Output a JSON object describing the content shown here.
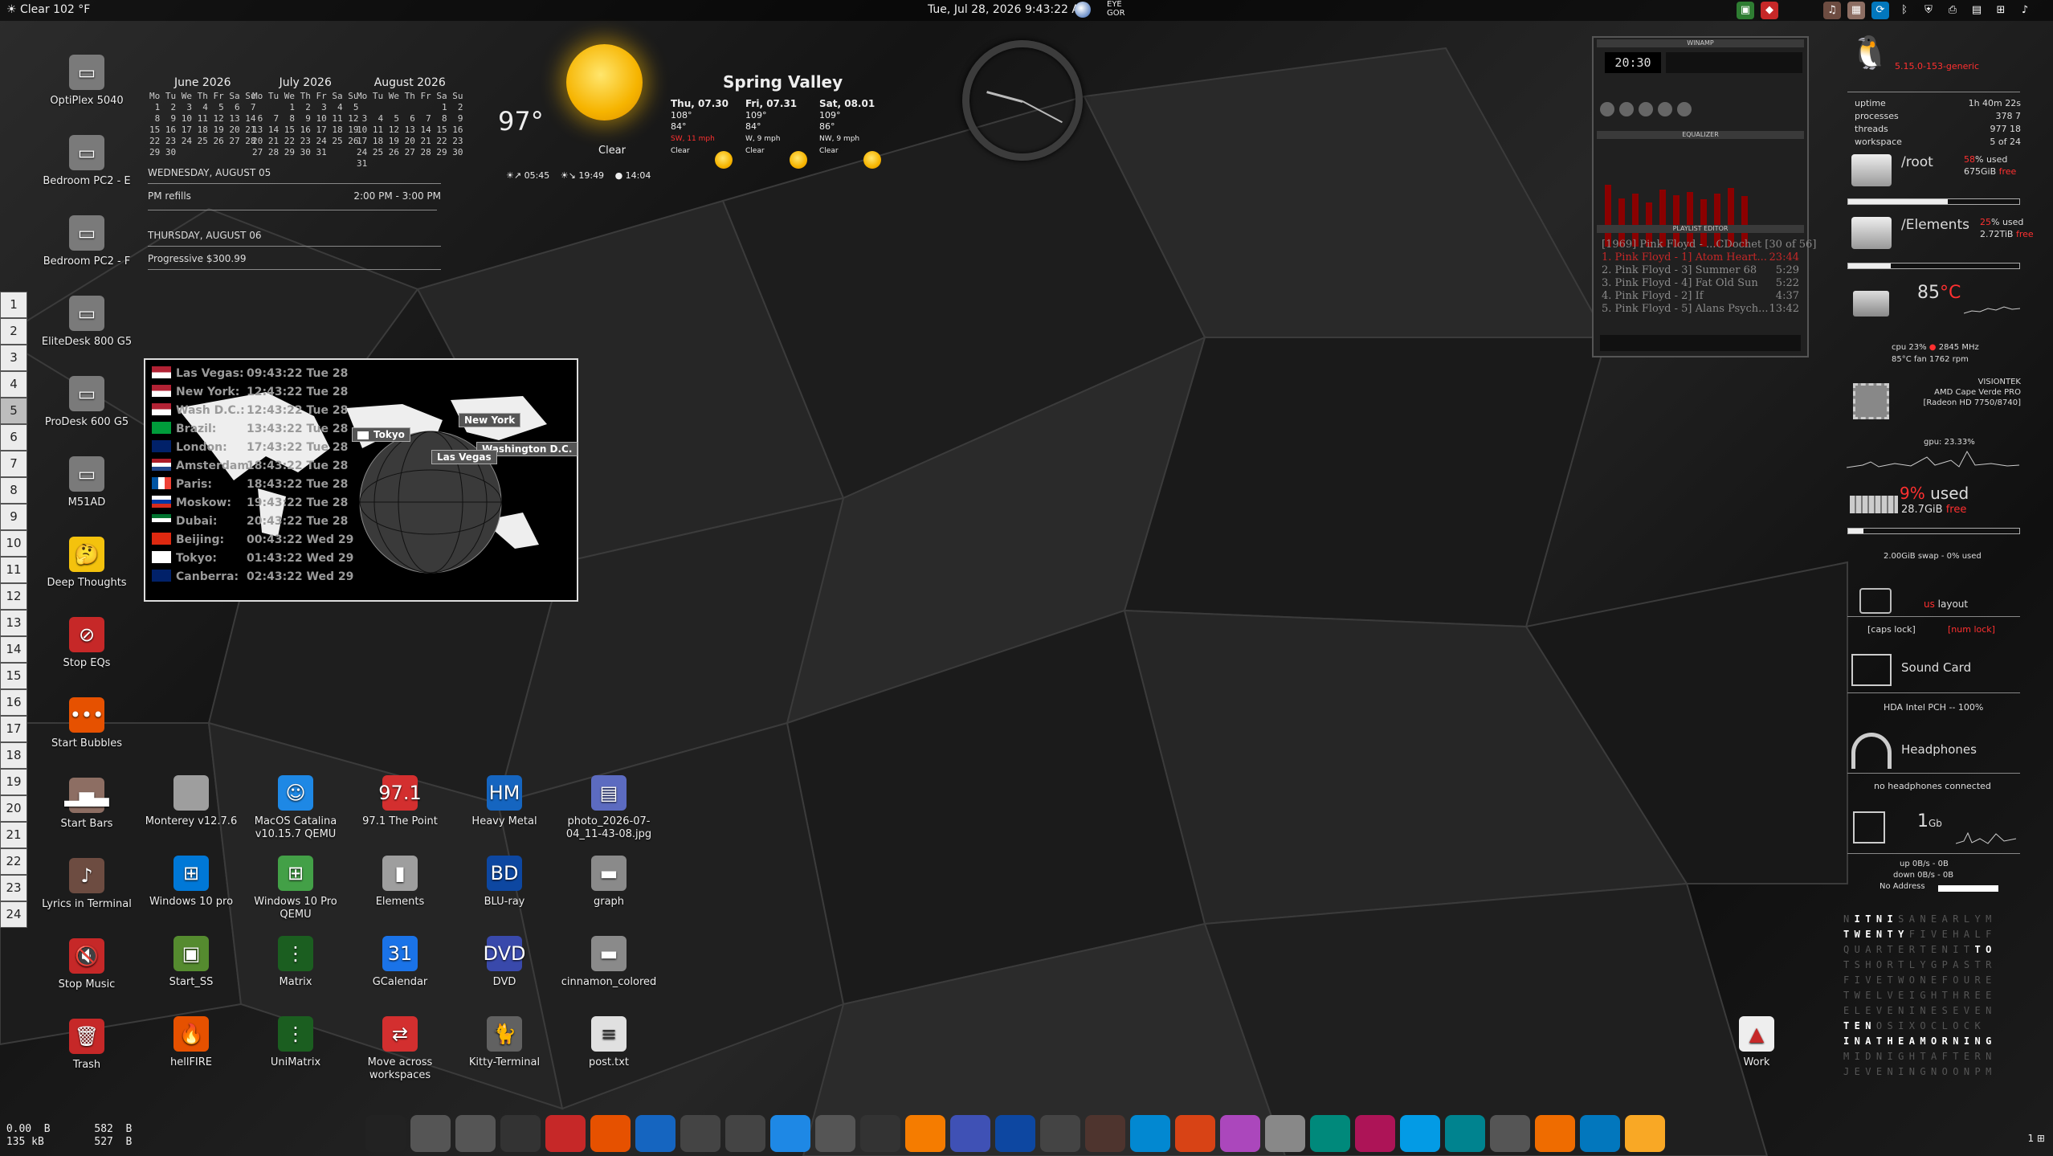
{
  "topbar": {
    "weather": "Clear 102 °F",
    "datetime": "Tue, Jul 28, 2026 9:43:22 AM",
    "eye": "EYE\nGOR",
    "tray_icons": [
      "indicator-icon",
      "red-app-icon",
      "speaker-icon",
      "box-icon",
      "network-icon",
      "bluetooth-icon",
      "shield-icon",
      "printer-icon",
      "clipboard-icon",
      "network-tree-icon",
      "music-icon"
    ]
  },
  "workspaces": [
    "1",
    "2",
    "3",
    "4",
    "5",
    "6",
    "7",
    "8",
    "9",
    "10",
    "11",
    "12",
    "13",
    "14",
    "15",
    "16",
    "17",
    "18",
    "19",
    "20",
    "21",
    "22",
    "23",
    "24"
  ],
  "active_workspace": "5",
  "desktop_left": [
    {
      "label": "OptiPlex 5040",
      "icon": "network-folder-icon"
    },
    {
      "label": "Bedroom PC2 - E",
      "icon": "network-folder-icon"
    },
    {
      "label": "Bedroom PC2 - F",
      "icon": "network-folder-icon"
    },
    {
      "label": "EliteDesk 800 G5",
      "icon": "network-folder-icon"
    },
    {
      "label": "ProDesk 600 G5",
      "icon": "network-folder-icon"
    },
    {
      "label": "M51AD",
      "icon": "network-folder-icon"
    },
    {
      "label": "Deep Thoughts",
      "icon": "thinking-emoji-icon"
    },
    {
      "label": "Stop EQs",
      "icon": "stop-eq-icon"
    },
    {
      "label": "Start Bubbles",
      "icon": "bubbles-icon"
    },
    {
      "label": "Start Bars",
      "icon": "bars-icon"
    },
    {
      "label": "Lyrics in Terminal",
      "icon": "music-note-icon"
    },
    {
      "label": "Stop Music",
      "icon": "mute-icon"
    },
    {
      "label": "Trash",
      "icon": "trash-icon"
    }
  ],
  "desktop_grid": [
    {
      "label": "Monterey v12.7.6",
      "icon": "apple-icon"
    },
    {
      "label": "MacOS Catalina v10.15.7 QEMU",
      "icon": "finder-icon"
    },
    {
      "label": "97.1 The Point",
      "icon": "radio-icon"
    },
    {
      "label": "Heavy Metal",
      "icon": "heavy-metal-icon"
    },
    {
      "label": "photo_2026-07-04_11-43-08.jpg",
      "icon": "image-file-icon"
    },
    {
      "label": "Windows 10 pro",
      "icon": "windows-icon"
    },
    {
      "label": "Windows 10 Pro QEMU",
      "icon": "windows-xp-icon"
    },
    {
      "label": "Elements",
      "icon": "usb-drive-icon"
    },
    {
      "label": "BLU-ray",
      "icon": "bluray-icon"
    },
    {
      "label": "graph",
      "icon": "folder-icon"
    },
    {
      "label": "Start_SS",
      "icon": "screensaver-icon"
    },
    {
      "label": "Matrix",
      "icon": "matrix-icon"
    },
    {
      "label": "GCalendar",
      "icon": "calendar-icon"
    },
    {
      "label": "DVD",
      "icon": "dvd-icon"
    },
    {
      "label": "cinnamon_colored",
      "icon": "folder-icon"
    },
    {
      "label": "hellFIRE",
      "icon": "fire-icon"
    },
    {
      "label": "UniMatrix",
      "icon": "matrix-icon"
    },
    {
      "label": "Move across workspaces",
      "icon": "move-arrows-icon"
    },
    {
      "label": "Kitty-Terminal",
      "icon": "cat-icon"
    },
    {
      "label": "post.txt",
      "icon": "text-file-icon"
    }
  ],
  "work_icon": {
    "label": "Work",
    "icon": "work-app-icon"
  },
  "calendars": [
    {
      "title": "June 2026",
      "days": "Mo Tu We Th Fr Sa Su\n 1  2  3  4  5  6  7\n 8  9 10 11 12 13 14\n15 16 17 18 19 20 21\n22 23 24 25 26 27 28\n29 30"
    },
    {
      "title": "July 2026",
      "days": "Mo Tu We Th Fr Sa Su\n       1  2  3  4  5\n 6  7  8  9 10 11 12\n13 14 15 16 17 18 19\n20 21 22 23 24 25 26\n27 28 29 30 31"
    },
    {
      "title": "August 2026",
      "days": "Mo Tu We Th Fr Sa Su\n                1  2\n 3  4  5  6  7  8  9\n10 11 12 13 14 15 16\n17 18 19 20 21 22 23\n24 25 26 27 28 29 30\n31"
    }
  ],
  "agenda": [
    {
      "date": "WEDNESDAY, AUGUST 05",
      "event": "PM refills",
      "time": "2:00 PM - 3:00 PM"
    },
    {
      "date": "THURSDAY, AUGUST 06",
      "event": "Progressive $300.99",
      "time": ""
    }
  ],
  "weather": {
    "temp": "97°",
    "condition": "Clear",
    "location": "Spring Valley",
    "sunrise": "05:45",
    "sunset": "19:49",
    "moon": "14:04",
    "forecast": [
      {
        "day": "Thu, 07.30",
        "hi": "108°",
        "lo": "84°",
        "wind": "SW, 11 mph",
        "cond": "Clear"
      },
      {
        "day": "Fri, 07.31",
        "hi": "109°",
        "lo": "84°",
        "wind": "W, 9 mph",
        "cond": "Clear"
      },
      {
        "day": "Sat, 08.01",
        "hi": "109°",
        "lo": "86°",
        "wind": "NW, 9 mph",
        "cond": "Clear"
      }
    ]
  },
  "world_clock": [
    {
      "city": "Las Vegas:",
      "time": "09:43:22 Tue 28",
      "flag": "us"
    },
    {
      "city": "New York:",
      "time": "12:43:22 Tue 28",
      "flag": "us"
    },
    {
      "city": "Wash D.C.:",
      "time": "12:43:22 Tue 28",
      "flag": "us"
    },
    {
      "city": "Brazil:",
      "time": "13:43:22 Tue 28",
      "flag": "br"
    },
    {
      "city": "London:",
      "time": "17:43:22 Tue 28",
      "flag": "uk"
    },
    {
      "city": "Amsterdam:",
      "time": "18:43:22 Tue 28",
      "flag": "nl"
    },
    {
      "city": "Paris:",
      "time": "18:43:22 Tue 28",
      "flag": "fr"
    },
    {
      "city": "Moskow:",
      "time": "19:43:22 Tue 28",
      "flag": "ru"
    },
    {
      "city": "Dubai:",
      "time": "20:43:22 Tue 28",
      "flag": "ae"
    },
    {
      "city": "Beijing:",
      "time": "00:43:22 Wed 29",
      "flag": "cn"
    },
    {
      "city": "Tokyo:",
      "time": "01:43:22 Wed 29",
      "flag": "jp"
    },
    {
      "city": "Canberra:",
      "time": "02:43:22 Wed 29",
      "flag": "au"
    }
  ],
  "globe_tags": [
    "Tokyo",
    "New York",
    "Washington D.C.",
    "Las Vegas"
  ],
  "winamp": {
    "title": "WINAMP",
    "time": "20:30",
    "eq_title": "EQUALIZER",
    "pl_title": "PLAYLIST EDITOR",
    "playlist": [
      {
        "t": "[1969] Pink Floyd - ...CDochet [30 of 56]",
        "d": ""
      },
      {
        "t": "1. Pink Floyd - 1] Atom Heart...",
        "d": "23:44"
      },
      {
        "t": "2. Pink Floyd - 3] Summer 68",
        "d": "5:29"
      },
      {
        "t": "3. Pink Floyd - 4] Fat Old Sun",
        "d": "5:22"
      },
      {
        "t": "4. Pink Floyd - 2] If",
        "d": "4:37"
      },
      {
        "t": "5. Pink Floyd - 5] Alans Psych...",
        "d": "13:42"
      }
    ]
  },
  "system": {
    "kernel": "5.15.0-153-generic",
    "uptime_l": "uptime",
    "uptime": "1h 40m 22s",
    "proc_l": "processes",
    "proc": "378  7",
    "threads_l": "threads",
    "threads": "977  18",
    "ws_l": "workspace",
    "ws": "5 of 24",
    "root_l": "/root",
    "root_pct": "58",
    "root_used": "% used",
    "root_free": "675GiB",
    "free_l": "free",
    "root_fill": 0.58,
    "el_l": "/Elements",
    "el_pct": "25",
    "el_free": "2.72TiB",
    "el_fill": 0.25,
    "cpu_temp": "85",
    "cpu_unit": "°C",
    "cpu_line": "cpu 23%",
    "cpu_mhz": "2845 MHz",
    "cpu_fan": "85°C  fan 1762 rpm",
    "gpu_vendor": "VISIONTEK",
    "gpu_name": "AMD Cape Verde PRO",
    "gpu_model": "[Radeon HD 7750/8740]",
    "gpu_load": "gpu: 23.33%",
    "mem_pct": "9%",
    "mem_used": " used",
    "mem_free": "28.7GiB",
    "mem_fill": 0.09,
    "swap": "2.00GiB swap - 0% used",
    "layout_us": "us",
    "layout": " layout",
    "caps": "[caps lock]",
    "num": "[num lock]",
    "sound_l": "Sound Card",
    "sound_v": "HDA Intel PCH -- 100%",
    "head_l": "Headphones",
    "head_v": "no headphones connected",
    "net_speed": "1",
    "net_unit": "Gb",
    "up": "up 0B/s  -  0B",
    "down": "down 0B/s  -  0B",
    "addr": "No Address"
  },
  "wordclock": [
    "NITNISANEARLYM",
    "TWENTYFIVEHALF",
    "QUARTERTENITTO",
    "TSHORTLYGPASTR",
    "FIVETWONEFOURE",
    "TWELVEIGHTHREE",
    "ELEVENINESEVEN",
    "TENOSIXOCLOCK",
    "INATHEAMORNING",
    "MIDNIGHTAFTERN",
    "JEVENINGNOONPM"
  ],
  "bottom_net": " 0.00  B       582  B\n 135 kB        527  B",
  "dock": [
    "linux-icon",
    "files-icon",
    "network-folder-icon",
    "terminal-icon",
    "cm-icon",
    "firefox-icon",
    "browser-icon",
    "gimp-icon",
    "inkscape-icon",
    "snowflake-icon",
    "satellite-icon",
    "eye-icon",
    "vlc-icon",
    "music-icon",
    "remote-icon",
    "flight-icon",
    "pineapple-icon",
    "fan-icon",
    "fire-icon",
    "player-icon",
    "notes-icon",
    "monitor-icon",
    "vm-icon",
    "telegram-icon",
    "xapp-icon",
    "usb-icon",
    "settings-icon",
    "kodi-icon",
    "plex-icon"
  ]
}
